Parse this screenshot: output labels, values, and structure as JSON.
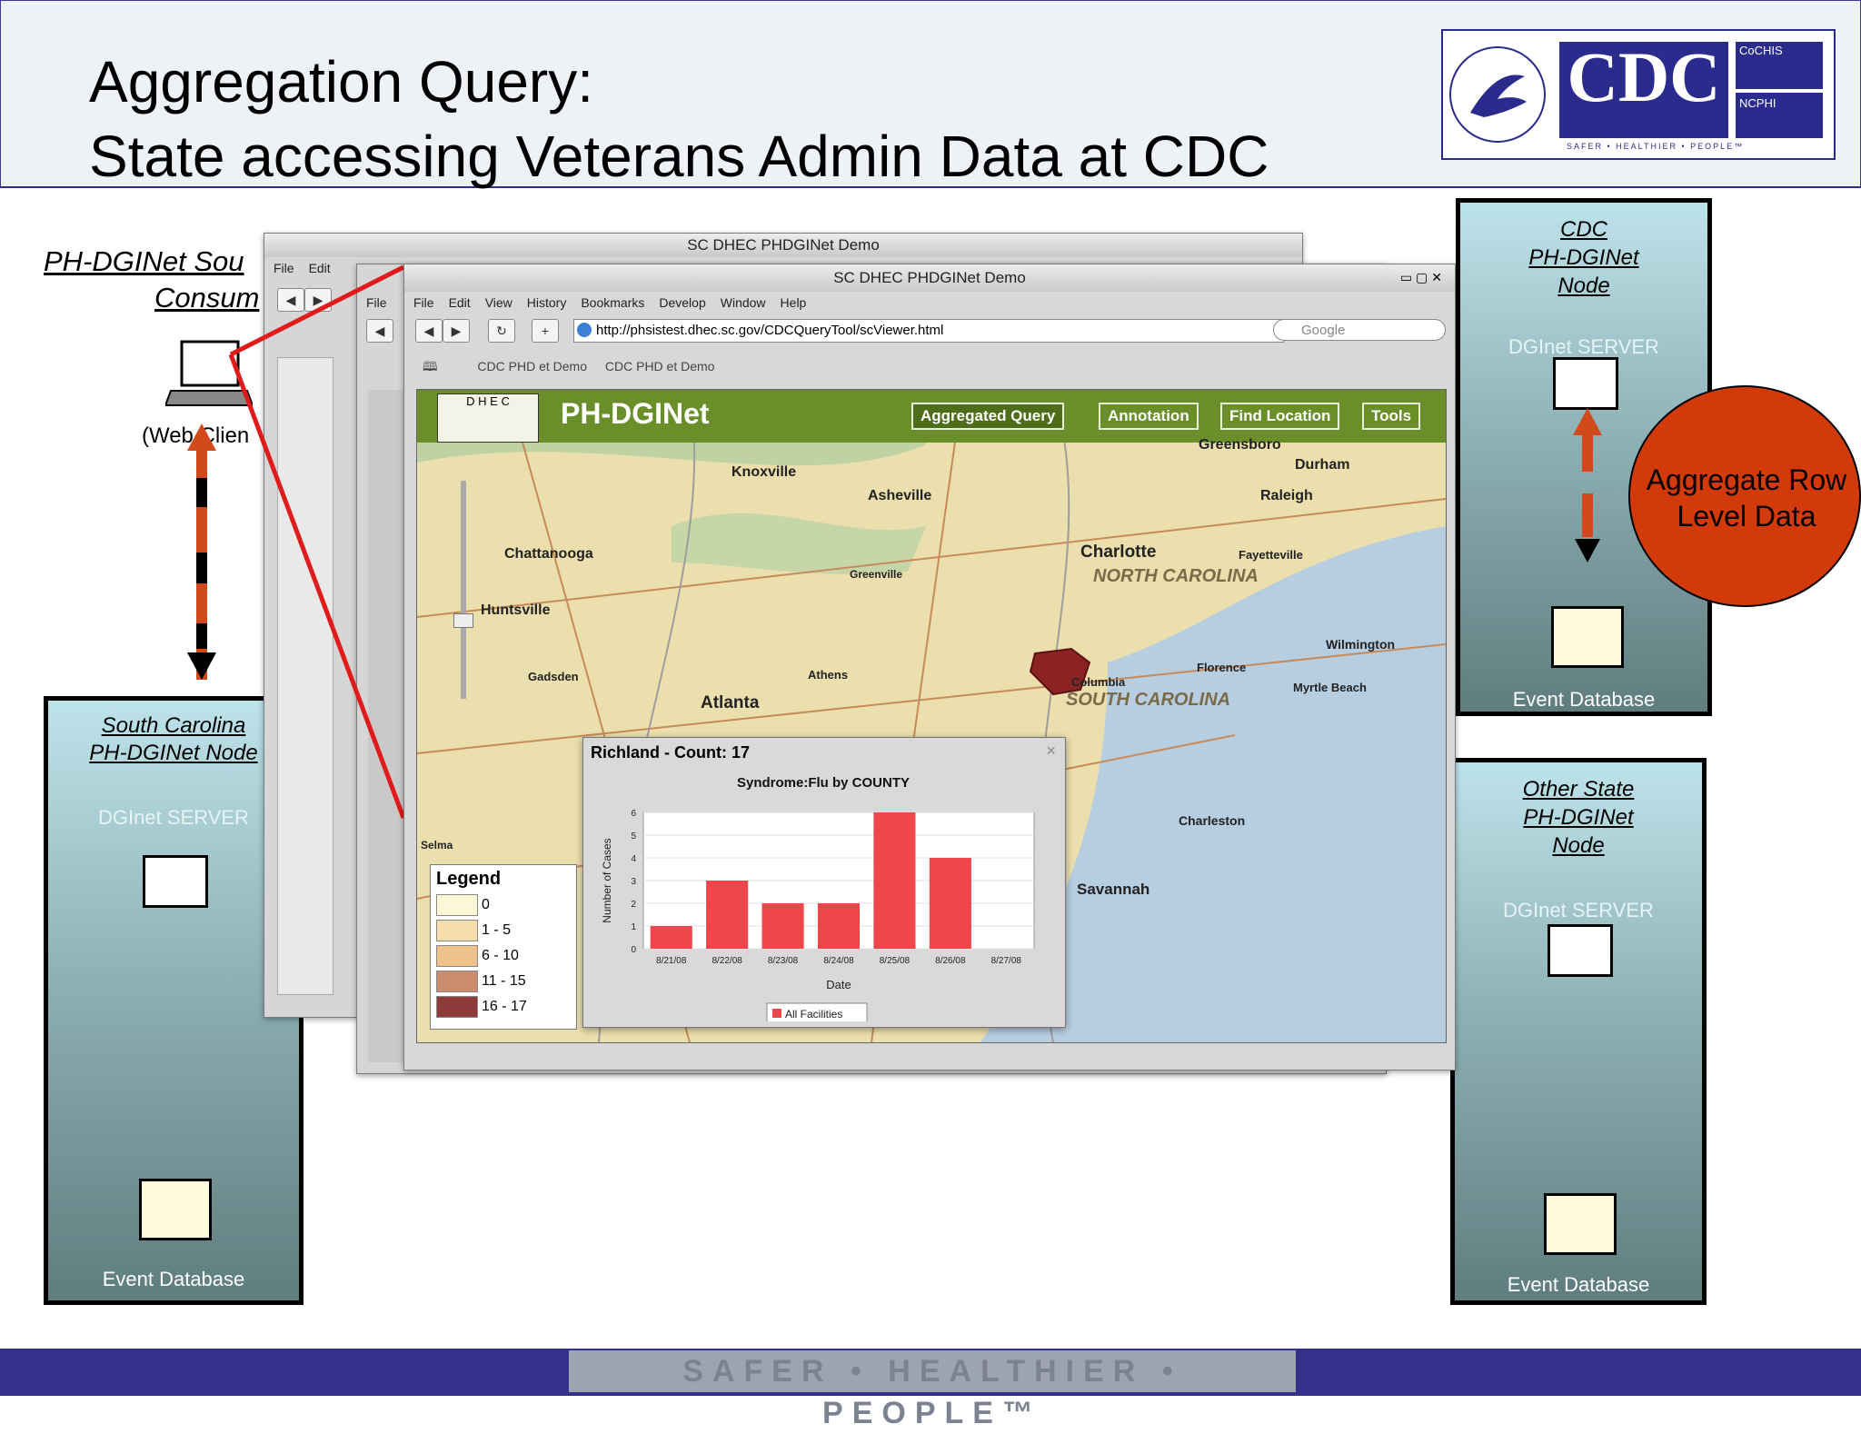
{
  "slide": {
    "title_line1": "Aggregation Query:",
    "title_line2": "State accessing Veterans Admin Data at CDC",
    "footer_text": "SAFER • HEALTHIER • PEOPLE™"
  },
  "logo": {
    "label": "CDC",
    "sub1": "CoCHIS",
    "sub2": "NCPHI",
    "tagline": "SAFER • HEALTHIER • PEOPLE™"
  },
  "left_client": {
    "title_line1": "PH-DGINet Sou",
    "title_line2": "Consum",
    "caption": "(Web Clien"
  },
  "sc_node": {
    "title_line1": "South Carolina",
    "title_line2": "PH-DGINet Node",
    "server": "DGInet SERVER",
    "db": "Event Database"
  },
  "cdc_node": {
    "title_line1": "CDC",
    "title_line2": "PH-DGINet",
    "title_line3": "Node",
    "server": "DGInet SERVER",
    "db": "Event Database"
  },
  "other_node": {
    "title_line1": "Other State",
    "title_line2": "PH-DGINet",
    "title_line3": "Node",
    "server": "DGInet SERVER",
    "db": "Event Database"
  },
  "aggregate_bubble": {
    "line1": "Aggregate Row",
    "line2": "Level Data"
  },
  "browser_back": {
    "title": "SC DHEC PHDGINet Demo",
    "menu": [
      "File",
      "Edit"
    ]
  },
  "browser_mid": {
    "menu": [
      "File"
    ],
    "tab": "CDC"
  },
  "browser_front": {
    "title": "SC DHEC PHDGINet Demo",
    "menu": [
      "File",
      "Edit",
      "View",
      "History",
      "Bookmarks",
      "Develop",
      "Window",
      "Help"
    ],
    "url": "http://phsistest.dhec.sc.gov/CDCQueryTool/scViewer.html",
    "search_placeholder": "Google",
    "bookmarks": [
      "CDC PHD   et Demo",
      "CDC PHD   et Demo"
    ]
  },
  "app": {
    "name": "PH-DGINet",
    "logo_letters": "D H E C",
    "nav": [
      "Aggregated Query",
      "Annotation",
      "Find Location",
      "Tools"
    ]
  },
  "map_labels": [
    "Knoxville",
    "Asheville",
    "Durham",
    "Raleigh",
    "Greensboro",
    "Chattanooga",
    "Charlotte",
    "Fayetteville",
    "NORTH CAROLINA",
    "Huntsville",
    "Greenville",
    "Wilmington",
    "Gadsden",
    "Athens",
    "Atlanta",
    "Columbia",
    "SOUTH CAROLINA",
    "Florence",
    "Myrtle Beach",
    "Charleston",
    "Savannah",
    "Selma"
  ],
  "legend": {
    "title": "Legend",
    "items": [
      {
        "label": "0",
        "color": "#fdf7d7"
      },
      {
        "label": "1 - 5",
        "color": "#f7ddaa"
      },
      {
        "label": "6 - 10",
        "color": "#eec08a"
      },
      {
        "label": "11 - 15",
        "color": "#c98d6b"
      },
      {
        "label": "16 - 17",
        "color": "#8c3a3a"
      }
    ]
  },
  "popup": {
    "header": "Richland - Count: 17",
    "close": "×"
  },
  "chart_data": {
    "type": "bar",
    "title": "Syndrome:Flu by COUNTY",
    "xlabel": "Date",
    "ylabel": "Number of Cases",
    "categories": [
      "8/21/08",
      "8/22/08",
      "8/23/08",
      "8/24/08",
      "8/25/08",
      "8/26/08",
      "8/27/08"
    ],
    "series": [
      {
        "name": "All Facilities",
        "values": [
          1,
          3,
          2,
          2,
          6,
          4,
          0
        ]
      }
    ],
    "ylim": [
      0,
      6
    ],
    "yticks": [
      "0",
      "1",
      "2",
      "3",
      "4",
      "5",
      "6"
    ],
    "color": "#f0454a",
    "grid": true,
    "legend_position": "bottom"
  }
}
